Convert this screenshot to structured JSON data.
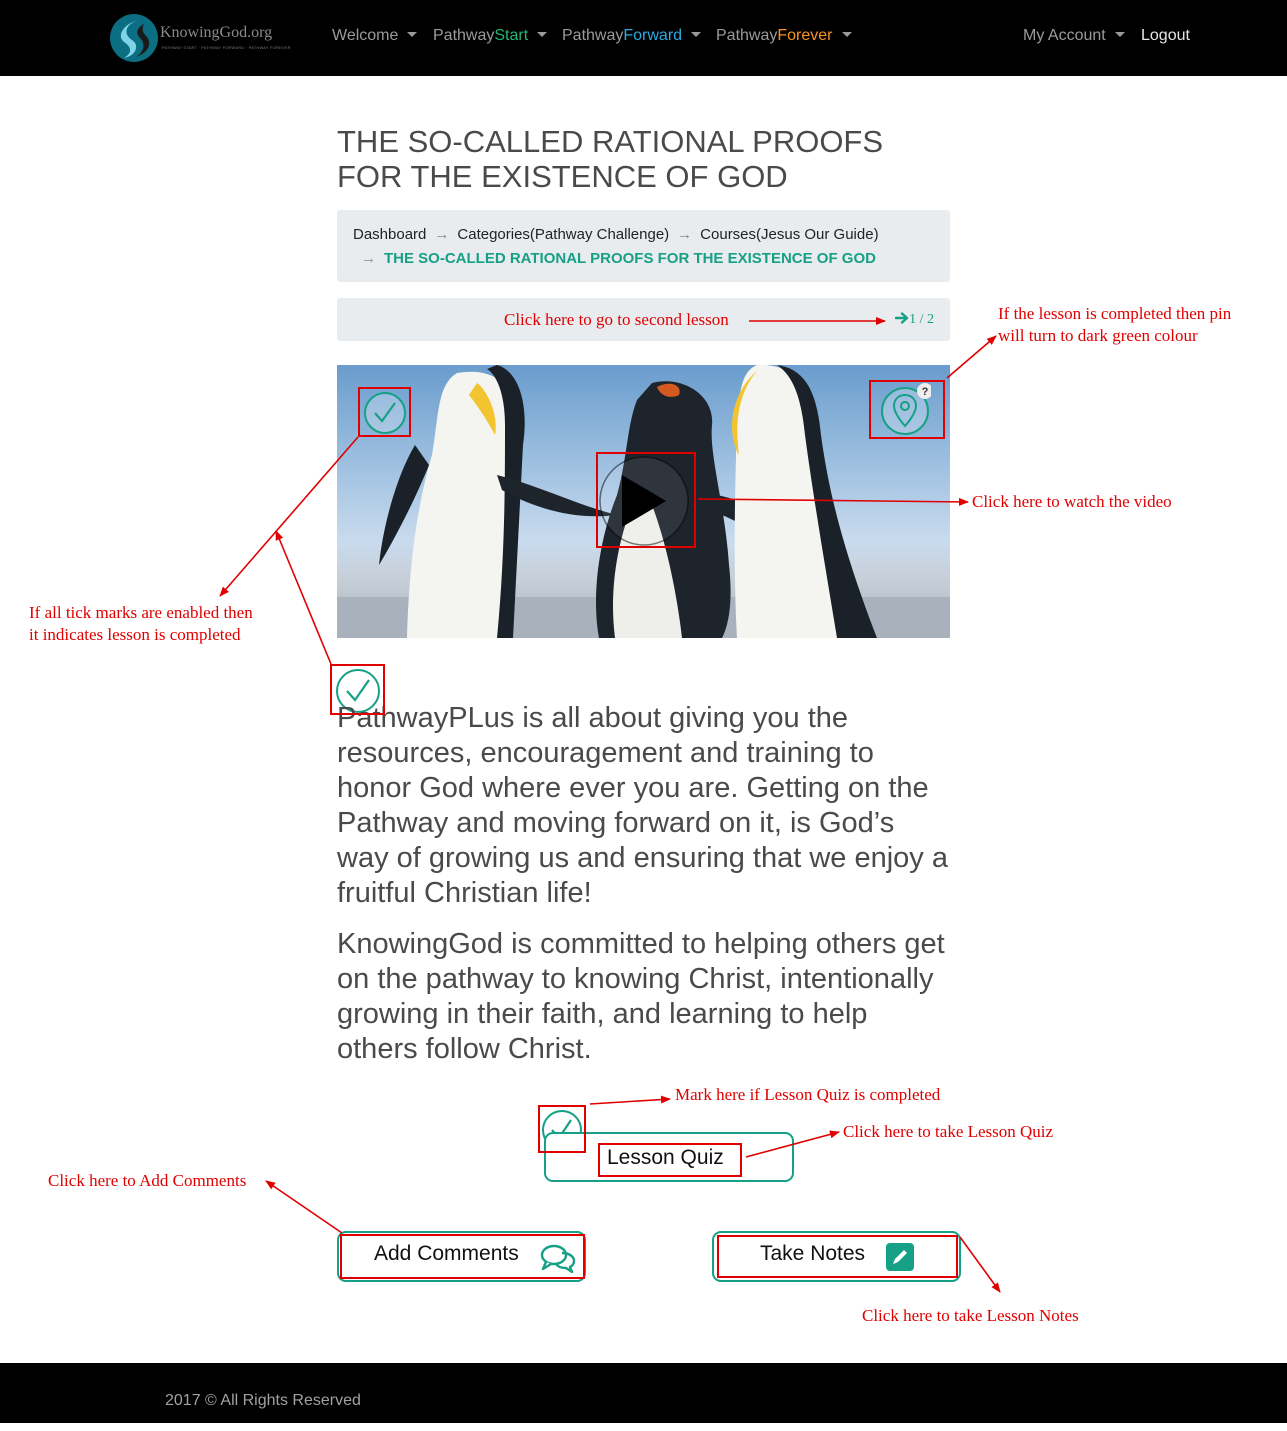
{
  "navbar": {
    "logo_text": "KnowingGod.org",
    "logo_tagline": "PATHWAY START · PATHWAY FORWARD · PATHWAY FOREVER",
    "welcome": "Welcome",
    "pathway_prefix": "Pathway",
    "start": "Start",
    "forward": "Forward",
    "forever": "Forever",
    "my_account": "My Account",
    "logout": "Logout",
    "colors": {
      "start": "#22b573",
      "forward": "#29abe2",
      "forever": "#f7931e"
    }
  },
  "page": {
    "title_line1": "THE SO-CALLED RATIONAL PROOFS",
    "title_line2": "FOR THE EXISTENCE OF GOD"
  },
  "breadcrumb": {
    "dashboard": "Dashboard",
    "categories": "Categories(Pathway Challenge)",
    "courses": "Courses(Jesus Our Guide)",
    "current": "THE SO-CALLED RATIONAL PROOFS FOR THE EXISTENCE OF GOD",
    "separator": "→"
  },
  "lesson_nav": {
    "counter": "1 / 2",
    "icon": "arrow-right-icon"
  },
  "video": {
    "thumbnail": "penguins",
    "play_icon": "play-icon",
    "tick_icon": "check-circle-icon",
    "pin_icon": "map-pin-icon",
    "pin_badge": "?"
  },
  "content": {
    "paragraph1": "PathwayPLus is all about giving you the resources, encouragement and training to honor God where ever you are. Getting on the Pathway and moving forward on it, is God’s way of growing us and ensuring that we enjoy a fruitful Christian life!",
    "paragraph2": "KnowingGod is committed to helping others get on the pathway to knowing Christ, intentionally growing in their faith, and learning to help others follow Christ."
  },
  "buttons": {
    "lesson_quiz": "Lesson Quiz",
    "add_comments": "Add Comments",
    "take_notes": "Take Notes"
  },
  "annotations": {
    "second_lesson": "Click here to go to second lesson",
    "pin_line1": "If the lesson is completed then pin",
    "pin_line2": "will turn to dark green colour",
    "watch_video": "Click here to watch the video",
    "tick_line1": "If all tick marks are enabled then",
    "tick_line2": "it indicates lesson is completed",
    "mark_quiz": "Mark here if Lesson Quiz is completed",
    "take_quiz": "Click here to take Lesson Quiz",
    "add_comments": "Click here to Add Comments",
    "take_notes": "Click here to take Lesson Notes"
  },
  "footer": {
    "text": "2017 © All Rights Reserved"
  },
  "theme": {
    "accent": "#16a085",
    "annotation": "#e00000"
  }
}
